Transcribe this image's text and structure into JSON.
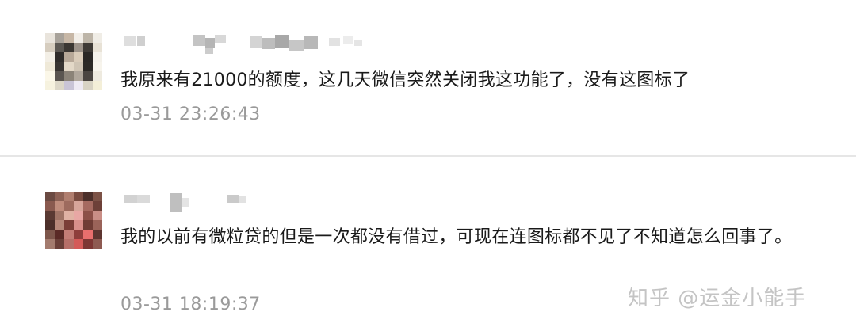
{
  "comments": [
    {
      "text": "我原来有21000的额度，这几天微信突然关闭我这功能了，没有这图标了",
      "time": "03-31 23:26:43"
    },
    {
      "text": "我的以前有微粒贷的但是一次都没有借过，可现在连图标都不见了不知道怎么回事了。",
      "time": "03-31 18:19:37"
    }
  ],
  "watermark": "知乎 @运金小能手",
  "colors": {
    "text": "#1a1a1a",
    "time": "#9a9a9a",
    "divider": "#e6e6e6",
    "watermark": "#c4c4c4"
  },
  "icons": [
    "avatar-pixelated",
    "username-pixelated"
  ]
}
